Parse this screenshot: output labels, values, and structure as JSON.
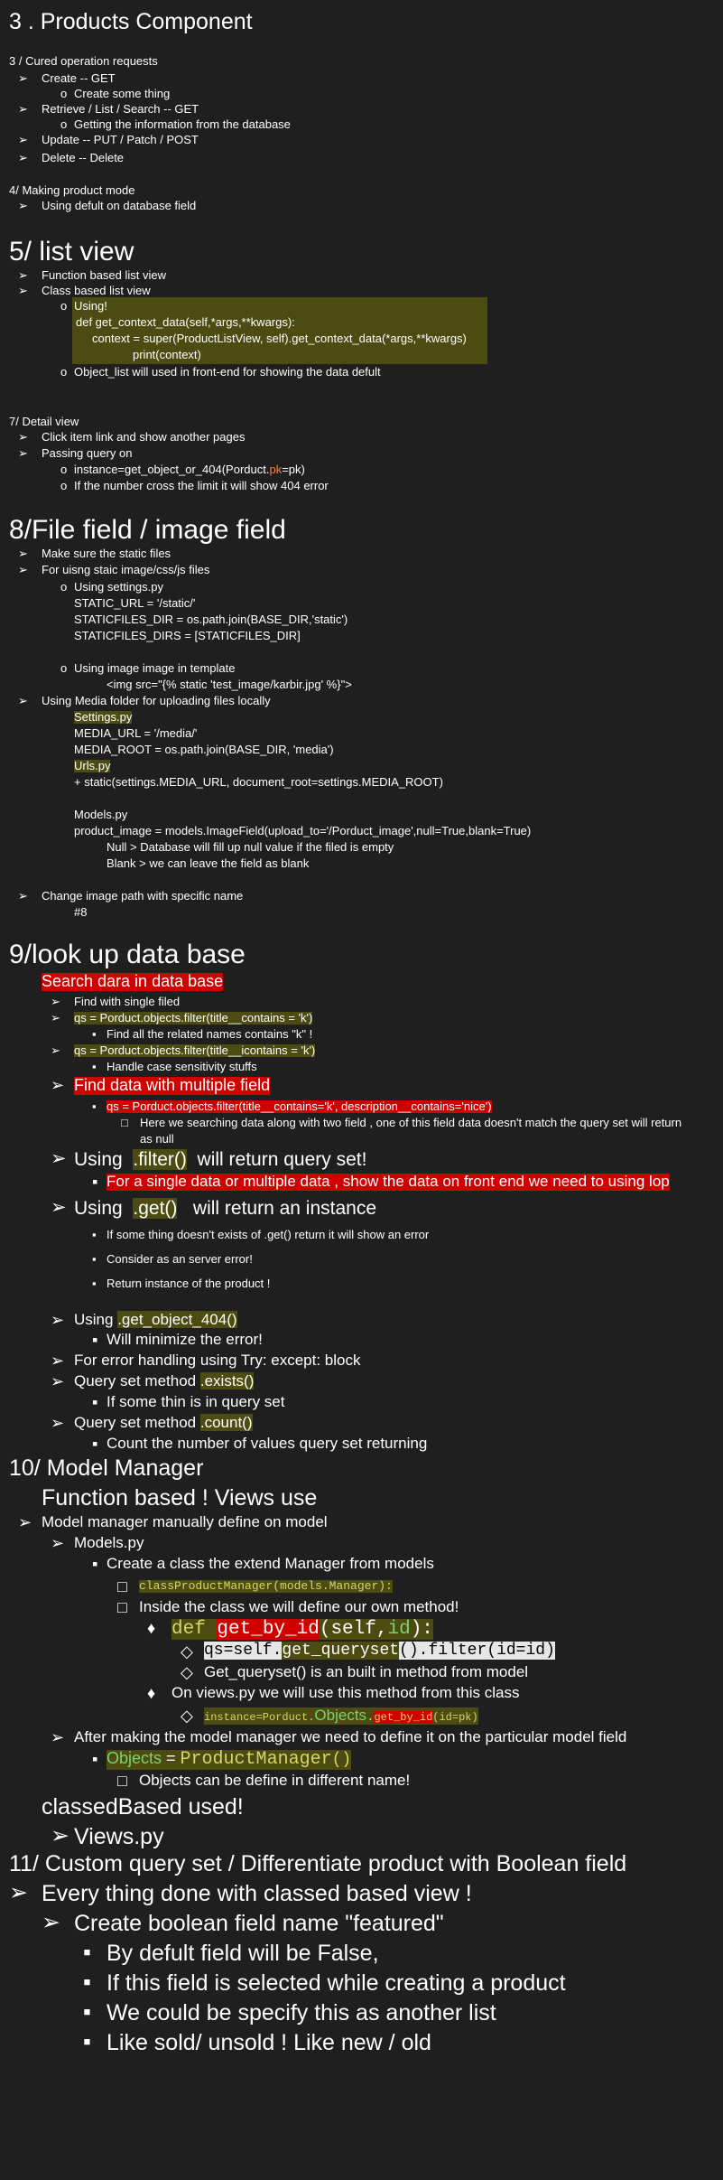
{
  "heading_3": "3 . Products Component",
  "s3": {
    "intro": "3 / Cured operation requests",
    "create": "Create --  GET",
    "create_sub": "Create some thing",
    "retrieve": "Retrieve / List / Search -- GET",
    "retrieve_sub": "Getting the information from the database",
    "update": "Update -- PUT / Patch / POST",
    "delete": "Delete -- Delete"
  },
  "s4": {
    "title": "4/ Making product mode",
    "item": "Using defult on database field"
  },
  "heading_5": "5/ list view",
  "s5": {
    "fb": "Function based list view",
    "cb": "Class based list view",
    "using": "Using!",
    "code1": "def get_context_data(self,*args,**kwargs):",
    "code2": "context = super(ProductListView, self).get_context_data(*args,**kwargs)",
    "code3": "print(context)",
    "object_list": "Object_list will used in front-end for showing the data defult"
  },
  "s7": {
    "title": "7/ Detail view",
    "click": "Click item link and show another pages",
    "passing": "Passing query on",
    "inst_a": "instance=get_object_or_404(Porduct.",
    "inst_pk": "pk",
    "inst_b": "=pk)",
    "limit": "If  the number cross the limit it will show 404 error"
  },
  "heading_8": "8/File field / image field",
  "s8": {
    "static": "Make sure the static files",
    "uisng": "For uisng staic image/css/js files",
    "using_settings": "Using settings.py",
    "static_url": "STATIC_URL = '/static/'",
    "staticfiles_dir": "STATICFILES_DIR = os.path.join(BASE_DIR,'static')",
    "staticfiles_dirs": "STATICFILES_DIRS = [STATICFILES_DIR]",
    "img_template": "Using image image in template",
    "img_tag": "<img src=\"{% static 'test_image/karbir.jpg' %}\">",
    "media": "Using Media folder for uploading files locally",
    "settings": "Settings.py",
    "media_url": "MEDIA_URL = '/media/'",
    "media_root": "MEDIA_ROOT = os.path.join(BASE_DIR, 'media')",
    "urls": "Urls.py",
    "static_call": "+ static(settings.MEDIA_URL, document_root=settings.MEDIA_ROOT)",
    "models": "Models.py",
    "product_image": "product_image  = models.ImageField(upload_to='/Porduct_image',null=True,blank=True)",
    "null": "Null > Database will fill up null value if the filed is empty",
    "blank": "Blank > we can leave the field as blank",
    "change_path": "Change image path  with specific name",
    "hash8": "#8"
  },
  "heading_9": "9/look up data base",
  "s9": {
    "search": "Search dara in data base",
    "single": "Find with single filed",
    "qs1": "qs = Porduct.objects.filter(title__contains = 'k')",
    "qs1_sub": "Find all the related names contains \"k\" !",
    "qs2": "qs = Porduct.objects.filter(title__icontains = 'k')",
    "qs2_sub": "Handle case sensitivity stuffs",
    "multiple": "Find data with multiple field",
    "qs3": "qs = Porduct.objects.filter(title__contains='k', description__contains='nice')",
    "qs3_sub1": "Here we searching data along with two field , one of this field data doesn't match the query set will return",
    "qs3_sub2": "as null",
    "using1": "Using",
    "filter_code": ".filter()",
    "filter_rest": "will return query set!",
    "front_end": "For a single data or multiple data , show the data on front end we need to using lop",
    "using2": "Using",
    "get_code": ".get()",
    "get_rest": "will return an instance",
    "get_sub1": "If some thing doesn't exists of .get() return it will show an error",
    "get_sub2": "Consider as an server error!",
    "get_sub3": "Return instance of the product !",
    "using3": "Using",
    "g404": ".get_object_404()",
    "g404_sub": "Will minimize the error!",
    "tryblock": "For error handling using Try: except: block",
    "qsm1": "Query set method",
    "exists": ".exists()",
    "exists_sub": "If some thin is in query set",
    "qsm2": "Query set method",
    "count": ".count()",
    "count_sub": "Count the number of values query set returning"
  },
  "heading_10": "10/ Model Manager",
  "s10": {
    "function_based": "Function based ! Views use",
    "manual": "Model manager manually define on model",
    "models": "Models.py",
    "create_class": "Create a class the extend Manager from models",
    "class_code": "classProductManager(models.Manager):",
    "inside": "Inside the class we will define our own method!",
    "def_kw": "def",
    "def_name": "get_by_id",
    "def_args_a": "(self,",
    "def_id": "id",
    "def_args_b": "):",
    "qs_self_a": "qs=self.",
    "qs_get": "get_queryset",
    "qs_paren": "()",
    "qs_filter": ".filter(id=id)",
    "builtin": "Get_queryset() is an built in method from model",
    "views_use": "On views.py we will use this method from this class",
    "inst_a": "instance=Porduct.",
    "inst_objects": "Objects",
    "inst_dot": ".",
    "inst_get": "get_by_id",
    "inst_b": "(id=pk)",
    "after": "After making the model manager we need to define it on the particular model field",
    "obj_a": "Objects",
    "obj_eq": " = ",
    "obj_pm": "ProductManager",
    "obj_paren": "()",
    "obj_diff": "Objects can be define in different name!",
    "class_based": "classedBased used!",
    "views_py": "Views.py"
  },
  "heading_11": "11/ Custom query set / Differentiate product with Boolean field",
  "s11": {
    "every": "Every thing done with classed based view !",
    "create_bool": "Create boolean field name \"featured\"",
    "default": "By defult field will be False,",
    "selected": "If this field is selected while creating a product",
    "specify": "We could be specify this as another list",
    "sold": "Like sold/ unsold ! Like new / old"
  }
}
